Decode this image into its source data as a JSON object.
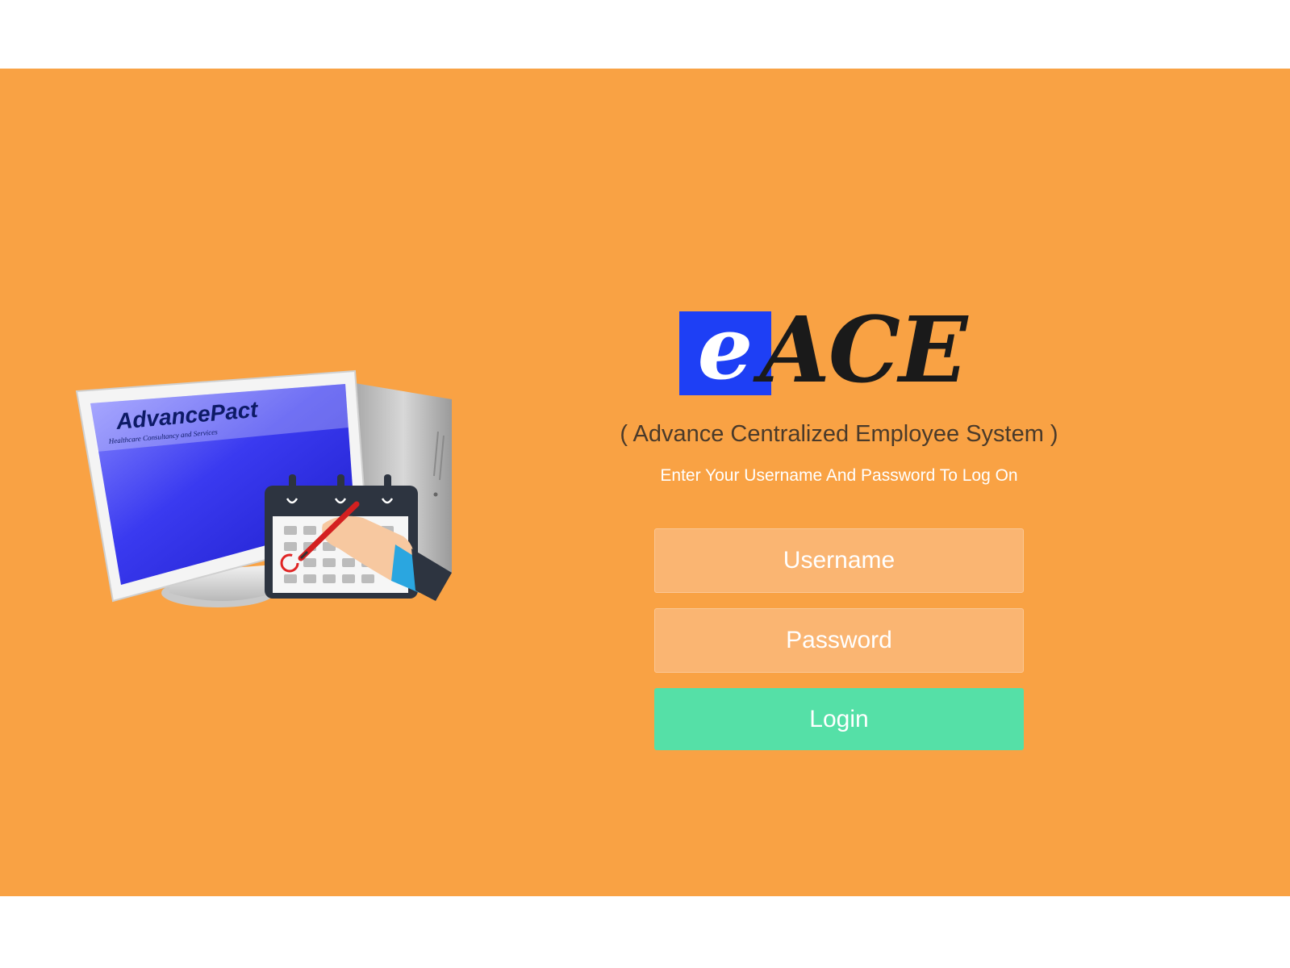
{
  "logo": {
    "e": "e",
    "ace": "ACE"
  },
  "illustration": {
    "brand_title": "AdvancePact",
    "brand_tagline": "Healthcare Consultancy and Services"
  },
  "login": {
    "subtitle": "( Advance Centralized Employee System )",
    "instruction": "Enter Your Username And Password To Log On",
    "username_placeholder": "Username",
    "password_placeholder": "Password",
    "button_label": "Login"
  },
  "colors": {
    "background": "#f9a244",
    "input_fill": "#fab572",
    "button": "#55e0a7",
    "logo_blue": "#1e3ff5"
  }
}
